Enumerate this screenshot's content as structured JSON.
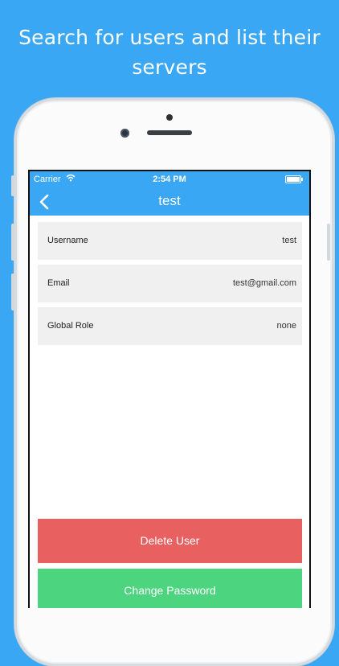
{
  "headline": {
    "line1": "Search for users and list their",
    "line2": "servers"
  },
  "status_bar": {
    "carrier": "Carrier",
    "time": "2:54 PM"
  },
  "navbar": {
    "title": "test",
    "back_icon": "chevron-left-icon"
  },
  "fields": [
    {
      "label": "Username",
      "value": "test"
    },
    {
      "label": "Email",
      "value": "test@gmail.com"
    },
    {
      "label": "Global Role",
      "value": "none"
    }
  ],
  "actions": {
    "delete_label": "Delete User",
    "change_password_label": "Change Password"
  },
  "colors": {
    "background": "#3aa7f5",
    "navbar": "#3aa7f5",
    "delete": "#e86060",
    "change_password": "#4cd47f",
    "row_background": "#f0f0f0"
  }
}
